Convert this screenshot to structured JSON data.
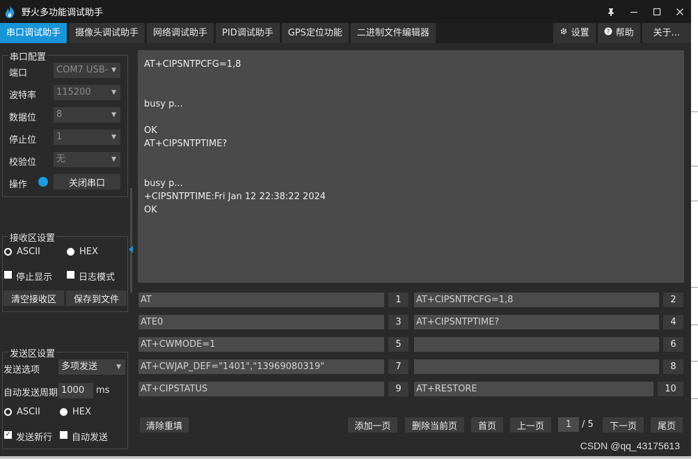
{
  "window": {
    "title": "野火多功能调试助手"
  },
  "tabs": [
    {
      "label": "串口调试助手",
      "active": true
    },
    {
      "label": "摄像头调试助手"
    },
    {
      "label": "网络调试助手"
    },
    {
      "label": "PID调试助手"
    },
    {
      "label": "GPS定位功能"
    },
    {
      "label": "二进制文件编辑器"
    }
  ],
  "tabs_right": {
    "settings": "设置",
    "help": "帮助",
    "about": "关于..."
  },
  "serial_config": {
    "title": "串口配置",
    "port_label": "端口",
    "port_value": "COM7 USB-",
    "baud_label": "波特率",
    "baud_value": "115200",
    "databits_label": "数据位",
    "databits_value": "8",
    "stopbits_label": "停止位",
    "stopbits_value": "1",
    "parity_label": "校验位",
    "parity_value": "无",
    "operate_label": "操作",
    "close_button": "关闭串口"
  },
  "receive_settings": {
    "title": "接收区设置",
    "ascii": "ASCII",
    "hex": "HEX",
    "stop_display": "停止显示",
    "log_mode": "日志模式",
    "clear_button": "清空接收区",
    "save_button": "保存到文件"
  },
  "send_settings": {
    "title": "发送区设置",
    "option_label": "发送选项",
    "option_value": "多项发送",
    "period_label": "自动发送周期",
    "period_value": "1000",
    "period_unit": "ms",
    "ascii": "ASCII",
    "hex": "HEX",
    "newline": "发送新行",
    "auto_send": "自动发送"
  },
  "receive_text": "AT+CIPSNTPCFG=1,8\n\n\nbusy p...\n\nOK\nAT+CIPSNTPTIME?\n\n\nbusy p...\n+CIPSNTPTIME:Fri Jan 12 22:38:22 2024\nOK",
  "commands": [
    {
      "text": "AT",
      "num": "1"
    },
    {
      "text": "AT+CIPSNTPCFG=1,8",
      "num": "2"
    },
    {
      "text": "ATE0",
      "num": "3"
    },
    {
      "text": "AT+CIPSNTPTIME?",
      "num": "4"
    },
    {
      "text": "AT+CWMODE=1",
      "num": "5"
    },
    {
      "text": "",
      "num": "6"
    },
    {
      "text": "AT+CWJAP_DEF=\"1401\",\"13969080319\"",
      "num": "7"
    },
    {
      "text": "",
      "num": "8"
    },
    {
      "text": "AT+CIPSTATUS",
      "num": "9"
    },
    {
      "text": "AT+RESTORE",
      "num": "10"
    }
  ],
  "footer": {
    "clear_refill": "清除重填",
    "add_page": "添加一页",
    "delete_page": "删除当前页",
    "first_page": "首页",
    "prev_page": "上一页",
    "current_page": "1",
    "total_pages": "/ 5",
    "next_page": "下一页",
    "last_page": "尾页"
  },
  "watermark": "CSDN @qq_43175613",
  "colors": {
    "accent": "#1795d6",
    "background": "#2a2a2a",
    "panel": "#4a4a4a"
  }
}
